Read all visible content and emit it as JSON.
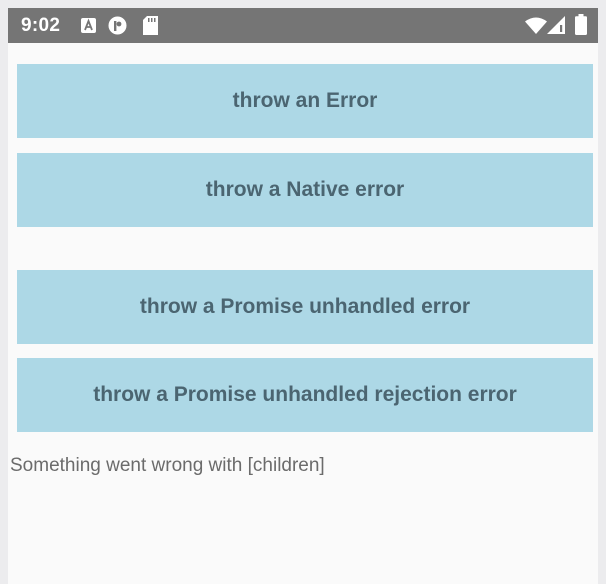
{
  "status_bar": {
    "time": "9:02",
    "icons": [
      "accessibility-a-icon",
      "app-notification-icon",
      "sd-card-icon",
      "wifi-icon",
      "signal-icon",
      "battery-icon"
    ]
  },
  "buttons": [
    {
      "label": "throw an Error"
    },
    {
      "label": "throw a Native error"
    },
    {
      "label": "throw a Promise unhandled error"
    },
    {
      "label": "throw a Promise unhandled rejection error"
    }
  ],
  "error_message": "Something went wrong with [children]",
  "colors": {
    "status_bar": "#757575",
    "button_bg": "#add8e6",
    "button_text": "#4b6571",
    "background": "#fafafa"
  }
}
